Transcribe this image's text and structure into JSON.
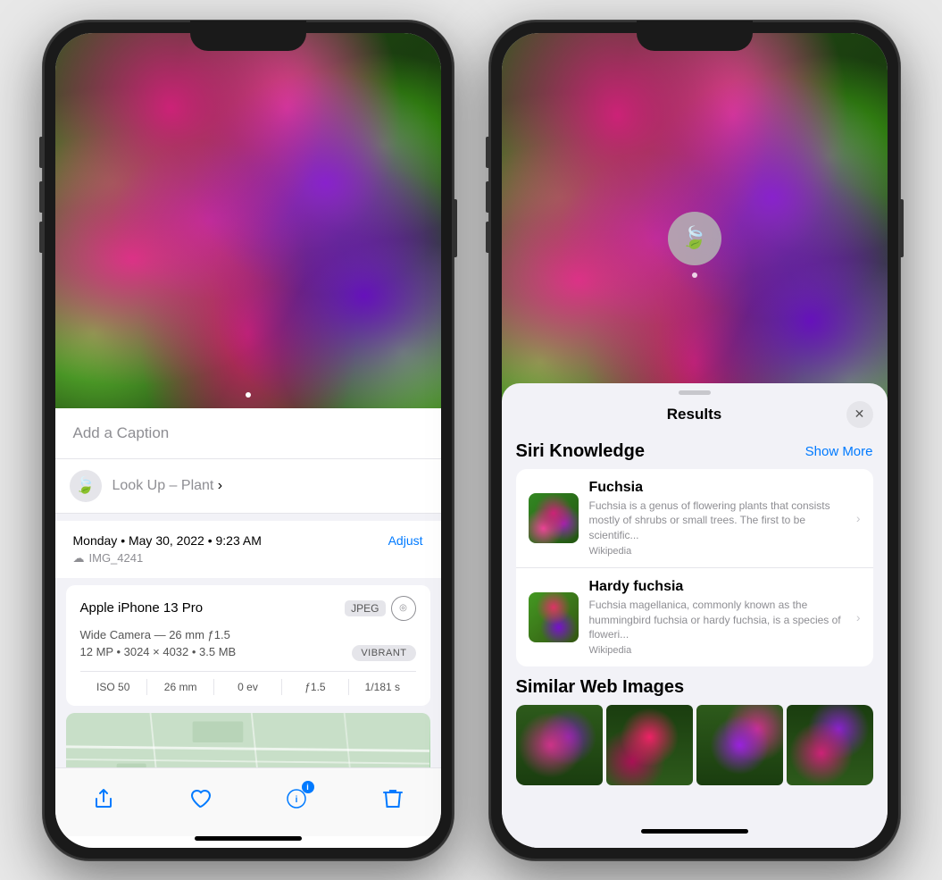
{
  "phones": {
    "left": {
      "caption_placeholder": "Add a Caption",
      "lookup_label": "Look Up – ",
      "lookup_subject": "Plant",
      "date_line1": "Monday • May 30, 2022 • 9:23 AM",
      "adjust_label": "Adjust",
      "filename_icon": "☁",
      "filename": "IMG_4241",
      "camera_model": "Apple iPhone 13 Pro",
      "jpeg_badge": "JPEG",
      "camera_detail": "Wide Camera — 26 mm ƒ1.5",
      "resolution": "12 MP • 3024 × 4032 • 3.5 MB",
      "vibrant_badge": "VIBRANT",
      "exif": [
        {
          "label": "ISO 50"
        },
        {
          "label": "26 mm"
        },
        {
          "label": "0 ev"
        },
        {
          "label": "ƒ1.5"
        },
        {
          "label": "1/181 s"
        }
      ],
      "toolbar": {
        "share": "⬆",
        "heart": "♡",
        "info": "✦",
        "info_badge": "i",
        "trash": "🗑"
      }
    },
    "right": {
      "sheet": {
        "title": "Results",
        "close_icon": "✕",
        "siri_knowledge_label": "Siri Knowledge",
        "show_more_label": "Show More",
        "items": [
          {
            "name": "Fuchsia",
            "description": "Fuchsia is a genus of flowering plants that consists mostly of shrubs or small trees. The first to be scientific...",
            "source": "Wikipedia"
          },
          {
            "name": "Hardy fuchsia",
            "description": "Fuchsia magellanica, commonly known as the hummingbird fuchsia or hardy fuchsia, is a species of floweri...",
            "source": "Wikipedia"
          }
        ],
        "similar_web_label": "Similar Web Images"
      }
    }
  }
}
